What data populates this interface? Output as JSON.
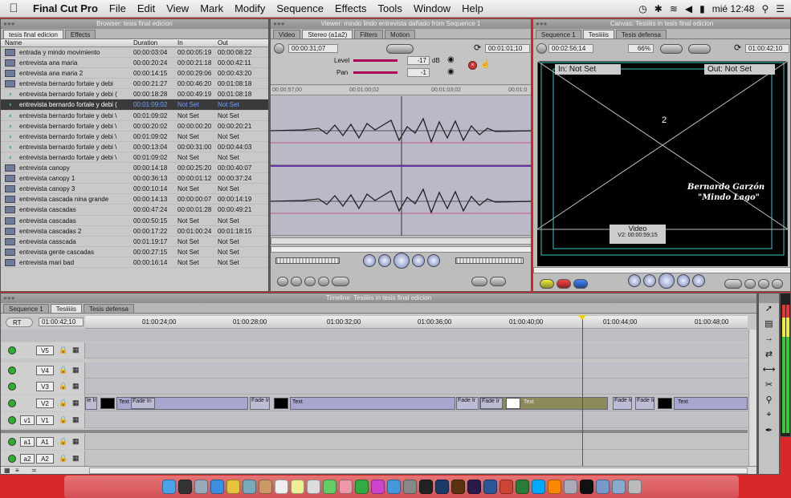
{
  "menubar": {
    "app": "Final Cut Pro",
    "items": [
      "File",
      "Edit",
      "View",
      "Mark",
      "Modify",
      "Sequence",
      "Effects",
      "Tools",
      "Window",
      "Help"
    ],
    "clock": "mié 12:48"
  },
  "browser": {
    "title": "Browser: tesis final edicion",
    "tabs": [
      "tesis final edicion",
      "Effects"
    ],
    "columns": [
      "Name",
      "Duration",
      "In",
      "Out"
    ],
    "rows": [
      {
        "name": "entrada y mindo movimiento",
        "duration": "00:00:03:04",
        "in": "00:00:05:19",
        "out": "00:00:08:22",
        "icon": "video"
      },
      {
        "name": "entrevista ana maria",
        "duration": "00:00:20:24",
        "in": "00:00:21:18",
        "out": "00:00:42:11",
        "icon": "video"
      },
      {
        "name": "entrevista ana maria 2",
        "duration": "00:00:14:15",
        "in": "00:00:29:06",
        "out": "00:00:43:20",
        "icon": "video"
      },
      {
        "name": "entrevista bernardo fortale y debi",
        "duration": "00:00:21:27",
        "in": "00:00:46:20",
        "out": "00:01:08:18",
        "icon": "video"
      },
      {
        "name": "entrevista bernardo fortale y debi (",
        "duration": "00:00:18:28",
        "in": "00:00:49:19",
        "out": "00:01:08:18",
        "icon": "audio"
      },
      {
        "name": "entrevista bernardo fortale y debi (",
        "duration": "00:01:09:02",
        "in": "Not Set",
        "out": "Not Set",
        "icon": "audio",
        "selected": true
      },
      {
        "name": "entrevista bernardo fortale y debi \\",
        "duration": "00:01:09:02",
        "in": "Not Set",
        "out": "Not Set",
        "icon": "audio"
      },
      {
        "name": "entrevista bernardo fortale y debi \\",
        "duration": "00:00:20:02",
        "in": "00:00:00:20",
        "out": "00:00:20:21",
        "icon": "audio"
      },
      {
        "name": "entrevista bernardo fortale y debi \\",
        "duration": "00:01:09:02",
        "in": "Not Set",
        "out": "Not Set",
        "icon": "audio"
      },
      {
        "name": "entrevista bernardo fortale y debi \\",
        "duration": "00:00:13:04",
        "in": "00:00:31:00",
        "out": "00:00:44:03",
        "icon": "audio"
      },
      {
        "name": "entrevista bernardo fortale y debi \\",
        "duration": "00:01:09:02",
        "in": "Not Set",
        "out": "Not Set",
        "icon": "audio"
      },
      {
        "name": "entrevista canopy",
        "duration": "00:00:14:18",
        "in": "00:00:25:20",
        "out": "00:00:40:07",
        "icon": "video"
      },
      {
        "name": "entrevista canopy 1",
        "duration": "00:00:36:13",
        "in": "00:00:01:12",
        "out": "00:00:37:24",
        "icon": "video"
      },
      {
        "name": "entrevista canopy 3",
        "duration": "00:00:10:14",
        "in": "Not Set",
        "out": "Not Set",
        "icon": "video"
      },
      {
        "name": "entrevista cascada nina grande",
        "duration": "00:00:14:13",
        "in": "00:00:00:07",
        "out": "00:00:14:19",
        "icon": "video"
      },
      {
        "name": "entrevista cascadas",
        "duration": "00:00:47:24",
        "in": "00:00:01:28",
        "out": "00:00:49:21",
        "icon": "video"
      },
      {
        "name": "entrevista cascadas",
        "duration": "00:00:50:15",
        "in": "Not Set",
        "out": "Not Set",
        "icon": "video"
      },
      {
        "name": "entrevista cascadas 2",
        "duration": "00:00:17:22",
        "in": "00:01:00:24",
        "out": "00:01:18:15",
        "icon": "video"
      },
      {
        "name": "entrevista casscada",
        "duration": "00:01:19:17",
        "in": "Not Set",
        "out": "Not Set",
        "icon": "video"
      },
      {
        "name": "entrevista gente cascadas",
        "duration": "00:00:27:15",
        "in": "Not Set",
        "out": "Not Set",
        "icon": "video"
      },
      {
        "name": "entrevista mari bad",
        "duration": "00:00:16:14",
        "in": "Not Set",
        "out": "Not Set",
        "icon": "video"
      }
    ]
  },
  "viewer": {
    "title": "Viewer: mindo lindo entrevista dañado from Sequence 1",
    "tabs": [
      "Video",
      "Stereo (a1a2)",
      "Filters",
      "Motion"
    ],
    "duration_tc": "00:00:31;07",
    "current_tc": "00:01:01;10",
    "level_label": "Level",
    "level_value": "-17",
    "level_unit": "dB",
    "pan_label": "Pan",
    "pan_value": "-1",
    "ruler_ticks": [
      "00:00:57;00",
      "00:01:00;02",
      "00:01:03;02",
      "00:01:0"
    ]
  },
  "canvas": {
    "title": "Canvas: Tesiiiiis in tesis final edicion",
    "tabs": [
      "Sequence 1",
      "Tesiiiiis",
      "Tesis defensa"
    ],
    "timecode": "00:02:56;14",
    "zoom": "66%",
    "current_tc": "01:00:42;10",
    "in_label": "In: Not Set",
    "out_label": "Out: Not Set",
    "overlay_line1": "Bernardo Garzón",
    "overlay_line2": "\"Mindo Lago\"",
    "clip_label": "Video",
    "clip_tc": "V2: 00:00:59;15",
    "center_mark": "2"
  },
  "timeline": {
    "title": "Timeline: Tesiiiiis in tesis final edicion",
    "tabs": [
      "Sequence 1",
      "Tesiiiiis",
      "Tesis defensa"
    ],
    "rt_label": "RT",
    "timecode": "01:00:42;10",
    "ruler": [
      "01:00:24;00",
      "01:00:28;00",
      "01:00:32;00",
      "01:00:36;00",
      "01:00:40;00",
      "01:00:44;00",
      "01:00:48;00"
    ],
    "tracks": [
      {
        "label": "V5"
      },
      {
        "label": "V4"
      },
      {
        "label": "V3"
      },
      {
        "label": "V2"
      },
      {
        "label": "V1",
        "src": "v1"
      },
      {
        "label": "A1",
        "src": "a1"
      },
      {
        "label": "A2",
        "src": "a2"
      }
    ],
    "clip_text": "Text",
    "fade_label": "Fade In",
    "fade_short": "Fade Ir",
    "fade_tiny": "le Ir",
    "playhead_colour": "#f0d000"
  },
  "colors": {
    "desktop": "#d8282a",
    "clip_purple": "#a6a6ce",
    "clip_olive": "#8a8a5c",
    "selected_text": "#6fa0ff",
    "canvas_guide": "#3cc4c4"
  }
}
